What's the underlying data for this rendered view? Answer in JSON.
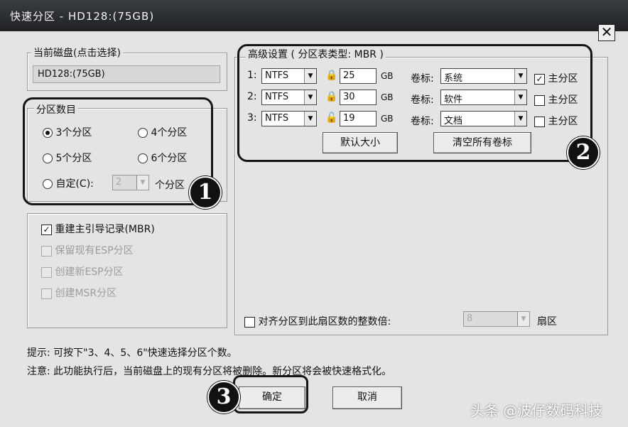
{
  "window": {
    "title": "快速分区 - HD128:(75GB)",
    "close_glyph": "✕"
  },
  "disk": {
    "legend": "当前磁盘(点击选择)",
    "value": "HD128:(75GB)"
  },
  "partition_count": {
    "legend": "分区数目",
    "options": [
      "3个分区",
      "4个分区",
      "5个分区",
      "6个分区"
    ],
    "selected": "3个分区",
    "custom_label": "自定(C):",
    "custom_value": "2",
    "custom_suffix": "个分区"
  },
  "options": {
    "rebuild_mbr": "重建主引导记录(MBR)",
    "keep_esp": "保留现有ESP分区",
    "create_esp": "创建新ESP分区",
    "create_msr": "创建MSR分区"
  },
  "advanced": {
    "legend": "高级设置 ( 分区表类型: MBR )",
    "rows": [
      {
        "index": "1:",
        "fs": "NTFS",
        "size": "25",
        "unit": "GB",
        "label_caption": "卷标:",
        "label": "系统",
        "primary_label": "主分区",
        "primary": true
      },
      {
        "index": "2:",
        "fs": "NTFS",
        "size": "30",
        "unit": "GB",
        "label_caption": "卷标:",
        "label": "软件",
        "primary_label": "主分区",
        "primary": false
      },
      {
        "index": "3:",
        "fs": "NTFS",
        "size": "19",
        "unit": "GB",
        "label_caption": "卷标:",
        "label": "文档",
        "primary_label": "主分区",
        "primary": false
      }
    ],
    "default_size_button": "默认大小",
    "clear_labels_button": "清空所有卷标"
  },
  "align": {
    "label": "对齐分区到此扇区数的整数倍:",
    "value": "8",
    "suffix": "扇区"
  },
  "hint": "提示: 可按下\"3、4、5、6\"快速选择分区个数。",
  "note": "注意: 此功能执行后，当前磁盘上的现有分区将被删除。新分区将会被快速格式化。",
  "buttons": {
    "ok": "确定",
    "cancel": "取消"
  },
  "markers": [
    "1",
    "2",
    "3"
  ],
  "watermark": "头条 @波仔数码科技",
  "icons": {
    "check": "✓",
    "dropdown": "▼",
    "lock": "🔒",
    "unlock": "🔓"
  }
}
